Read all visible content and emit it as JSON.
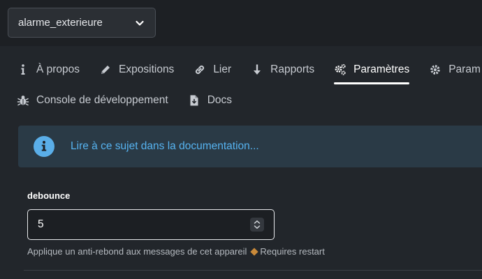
{
  "device_selector": {
    "value": "alarme_exterieure"
  },
  "tabs_row1": [
    {
      "label": "À propos",
      "icon": "info-icon"
    },
    {
      "label": "Expositions",
      "icon": "pencil-icon"
    },
    {
      "label": "Lier",
      "icon": "link-icon"
    },
    {
      "label": "Rapports",
      "icon": "arrow-down-icon"
    },
    {
      "label": "Paramètres",
      "icon": "gears-icon",
      "active": true
    },
    {
      "label": "Param",
      "icon": "gear-icon"
    }
  ],
  "tabs_row2": [
    {
      "label": "Console de développement",
      "icon": "bug-icon"
    },
    {
      "label": "Docs",
      "icon": "file-download-icon"
    }
  ],
  "info_banner": {
    "link_text": "Lire à ce sujet dans la documentation..."
  },
  "field": {
    "label": "debounce",
    "value": "5",
    "help_text": "Applique un anti-rebond aux messages de cet appareil",
    "restart_note": "Requires restart"
  },
  "colors": {
    "accent_blue": "#56b3f0",
    "info_bg": "#2a3a46",
    "restart_diamond": "#c98a3a"
  }
}
